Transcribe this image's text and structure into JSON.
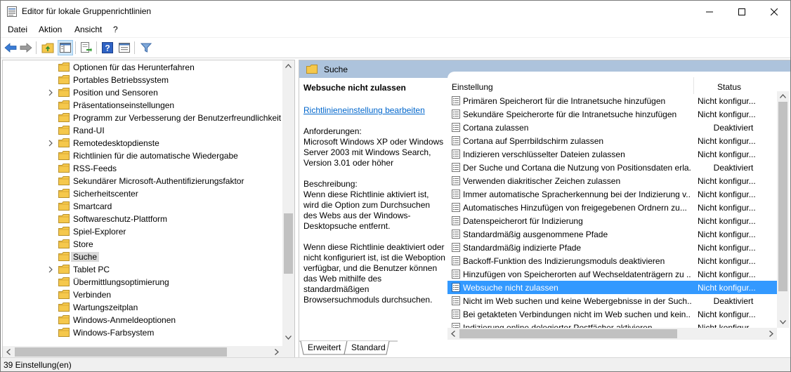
{
  "window": {
    "title": "Editor für lokale Gruppenrichtlinien"
  },
  "menu": [
    "Datei",
    "Aktion",
    "Ansicht",
    "?"
  ],
  "tree": {
    "items": [
      {
        "label": "Optionen für das Herunterfahren",
        "expandable": false
      },
      {
        "label": "Portables Betriebssystem",
        "expandable": false
      },
      {
        "label": "Position und Sensoren",
        "expandable": true
      },
      {
        "label": "Präsentationseinstellungen",
        "expandable": false
      },
      {
        "label": "Programm zur Verbesserung der Benutzerfreundlichkeit",
        "expandable": false
      },
      {
        "label": "Rand-UI",
        "expandable": false
      },
      {
        "label": "Remotedesktopdienste",
        "expandable": true
      },
      {
        "label": "Richtlinien für die automatische Wiedergabe",
        "expandable": false
      },
      {
        "label": "RSS-Feeds",
        "expandable": false
      },
      {
        "label": "Sekundärer Microsoft-Authentifizierungsfaktor",
        "expandable": false
      },
      {
        "label": "Sicherheitscenter",
        "expandable": false
      },
      {
        "label": "Smartcard",
        "expandable": false
      },
      {
        "label": "Softwareschutz-Plattform",
        "expandable": false
      },
      {
        "label": "Spiel-Explorer",
        "expandable": false
      },
      {
        "label": "Store",
        "expandable": false
      },
      {
        "label": "Suche",
        "expandable": false,
        "selected": true
      },
      {
        "label": "Tablet PC",
        "expandable": true
      },
      {
        "label": "Übermittlungsoptimierung",
        "expandable": false
      },
      {
        "label": "Verbinden",
        "expandable": false
      },
      {
        "label": "Wartungszeitplan",
        "expandable": false
      },
      {
        "label": "Windows-Anmeldeoptionen",
        "expandable": false
      },
      {
        "label": "Windows-Farbsystem",
        "expandable": false
      }
    ]
  },
  "right": {
    "header": "Suche",
    "description": {
      "title": "Websuche nicht zulassen",
      "link": "Richtlinieneinstellung bearbeiten",
      "requirements": "Anforderungen:\nMicrosoft Windows XP oder Windows Server 2003 mit Windows Search, Version 3.01 oder höher",
      "description": "Beschreibung:\nWenn diese Richtlinie aktiviert ist, wird die Option zum Durchsuchen des Webs aus der Windows-Desktopsuche entfernt.",
      "description2": "Wenn diese Richtlinie deaktiviert oder nicht konfiguriert ist, ist die Weboption verfügbar, und die Benutzer können das Web mithilfe des standardmäßigen Browsersuchmoduls durchsuchen."
    },
    "columns": {
      "setting": "Einstellung",
      "status": "Status"
    },
    "rows": [
      {
        "name": "Primären Speicherort für die Intranetsuche hinzufügen",
        "status": "Nicht konfigur...",
        "center": false
      },
      {
        "name": "Sekundäre Speicherorte für die Intranetsuche hinzufügen",
        "status": "Nicht konfigur...",
        "center": false
      },
      {
        "name": "Cortana zulassen",
        "status": "Deaktiviert",
        "center": true
      },
      {
        "name": "Cortana auf Sperrbildschirm zulassen",
        "status": "Nicht konfigur...",
        "center": false
      },
      {
        "name": "Indizieren verschlüsselter Dateien zulassen",
        "status": "Nicht konfigur...",
        "center": false
      },
      {
        "name": "Der Suche und Cortana die Nutzung von Positionsdaten erla...",
        "status": "Deaktiviert",
        "center": true
      },
      {
        "name": "Verwenden diakritischer Zeichen zulassen",
        "status": "Nicht konfigur...",
        "center": false
      },
      {
        "name": "Immer automatische Spracherkennung bei der Indizierung v...",
        "status": "Nicht konfigur...",
        "center": false
      },
      {
        "name": "Automatisches Hinzufügen von freigegebenen Ordnern zu...",
        "status": "Nicht konfigur...",
        "center": false
      },
      {
        "name": "Datenspeicherort für Indizierung",
        "status": "Nicht konfigur...",
        "center": false
      },
      {
        "name": "Standardmäßig ausgenommene Pfade",
        "status": "Nicht konfigur...",
        "center": false
      },
      {
        "name": "Standardmäßig indizierte Pfade",
        "status": "Nicht konfigur...",
        "center": false
      },
      {
        "name": "Backoff-Funktion des Indizierungsmoduls deaktivieren",
        "status": "Nicht konfigur...",
        "center": false
      },
      {
        "name": "Hinzufügen von Speicherorten auf Wechseldatenträgern zu ...",
        "status": "Nicht konfigur...",
        "center": false
      },
      {
        "name": "Websuche nicht zulassen",
        "status": "Nicht konfigur...",
        "center": false,
        "selected": true
      },
      {
        "name": "Nicht im Web suchen und keine Webergebnisse in der Such...",
        "status": "Deaktiviert",
        "center": true
      },
      {
        "name": "Bei getakteten Verbindungen nicht im Web suchen und kein...",
        "status": "Nicht konfigur...",
        "center": false
      },
      {
        "name": "Indizierung online delegierter Postfächer aktivieren",
        "status": "Nicht konfigur...",
        "center": false
      }
    ],
    "tabs": [
      "Erweitert",
      "Standard"
    ]
  },
  "status": {
    "text": "39 Einstellung(en)"
  },
  "colors": {
    "selection": "#3399ff",
    "header": "#adc3dc",
    "link": "#0066cc",
    "folder": "#f5c84c"
  }
}
